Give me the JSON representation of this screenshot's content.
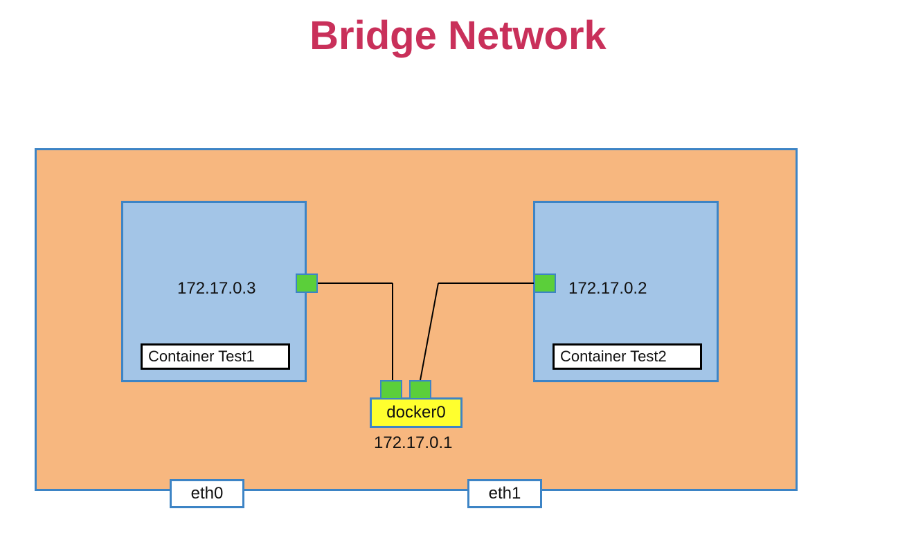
{
  "title": "Bridge Network",
  "host": {
    "interfaces": [
      "eth0",
      "eth1"
    ]
  },
  "bridge": {
    "name": "docker0",
    "ip": "172.17.0.1"
  },
  "containers": [
    {
      "name": "Container Test1",
      "ip": "172.17.0.3"
    },
    {
      "name": "Container Test2",
      "ip": "172.17.0.2"
    }
  ],
  "colors": {
    "title": "#c9305a",
    "host_fill": "#f7b77f",
    "border": "#3d84c5",
    "container_fill": "#a3c5e7",
    "port_fill": "#5bcf3a",
    "bridge_fill": "#ffff2e"
  }
}
